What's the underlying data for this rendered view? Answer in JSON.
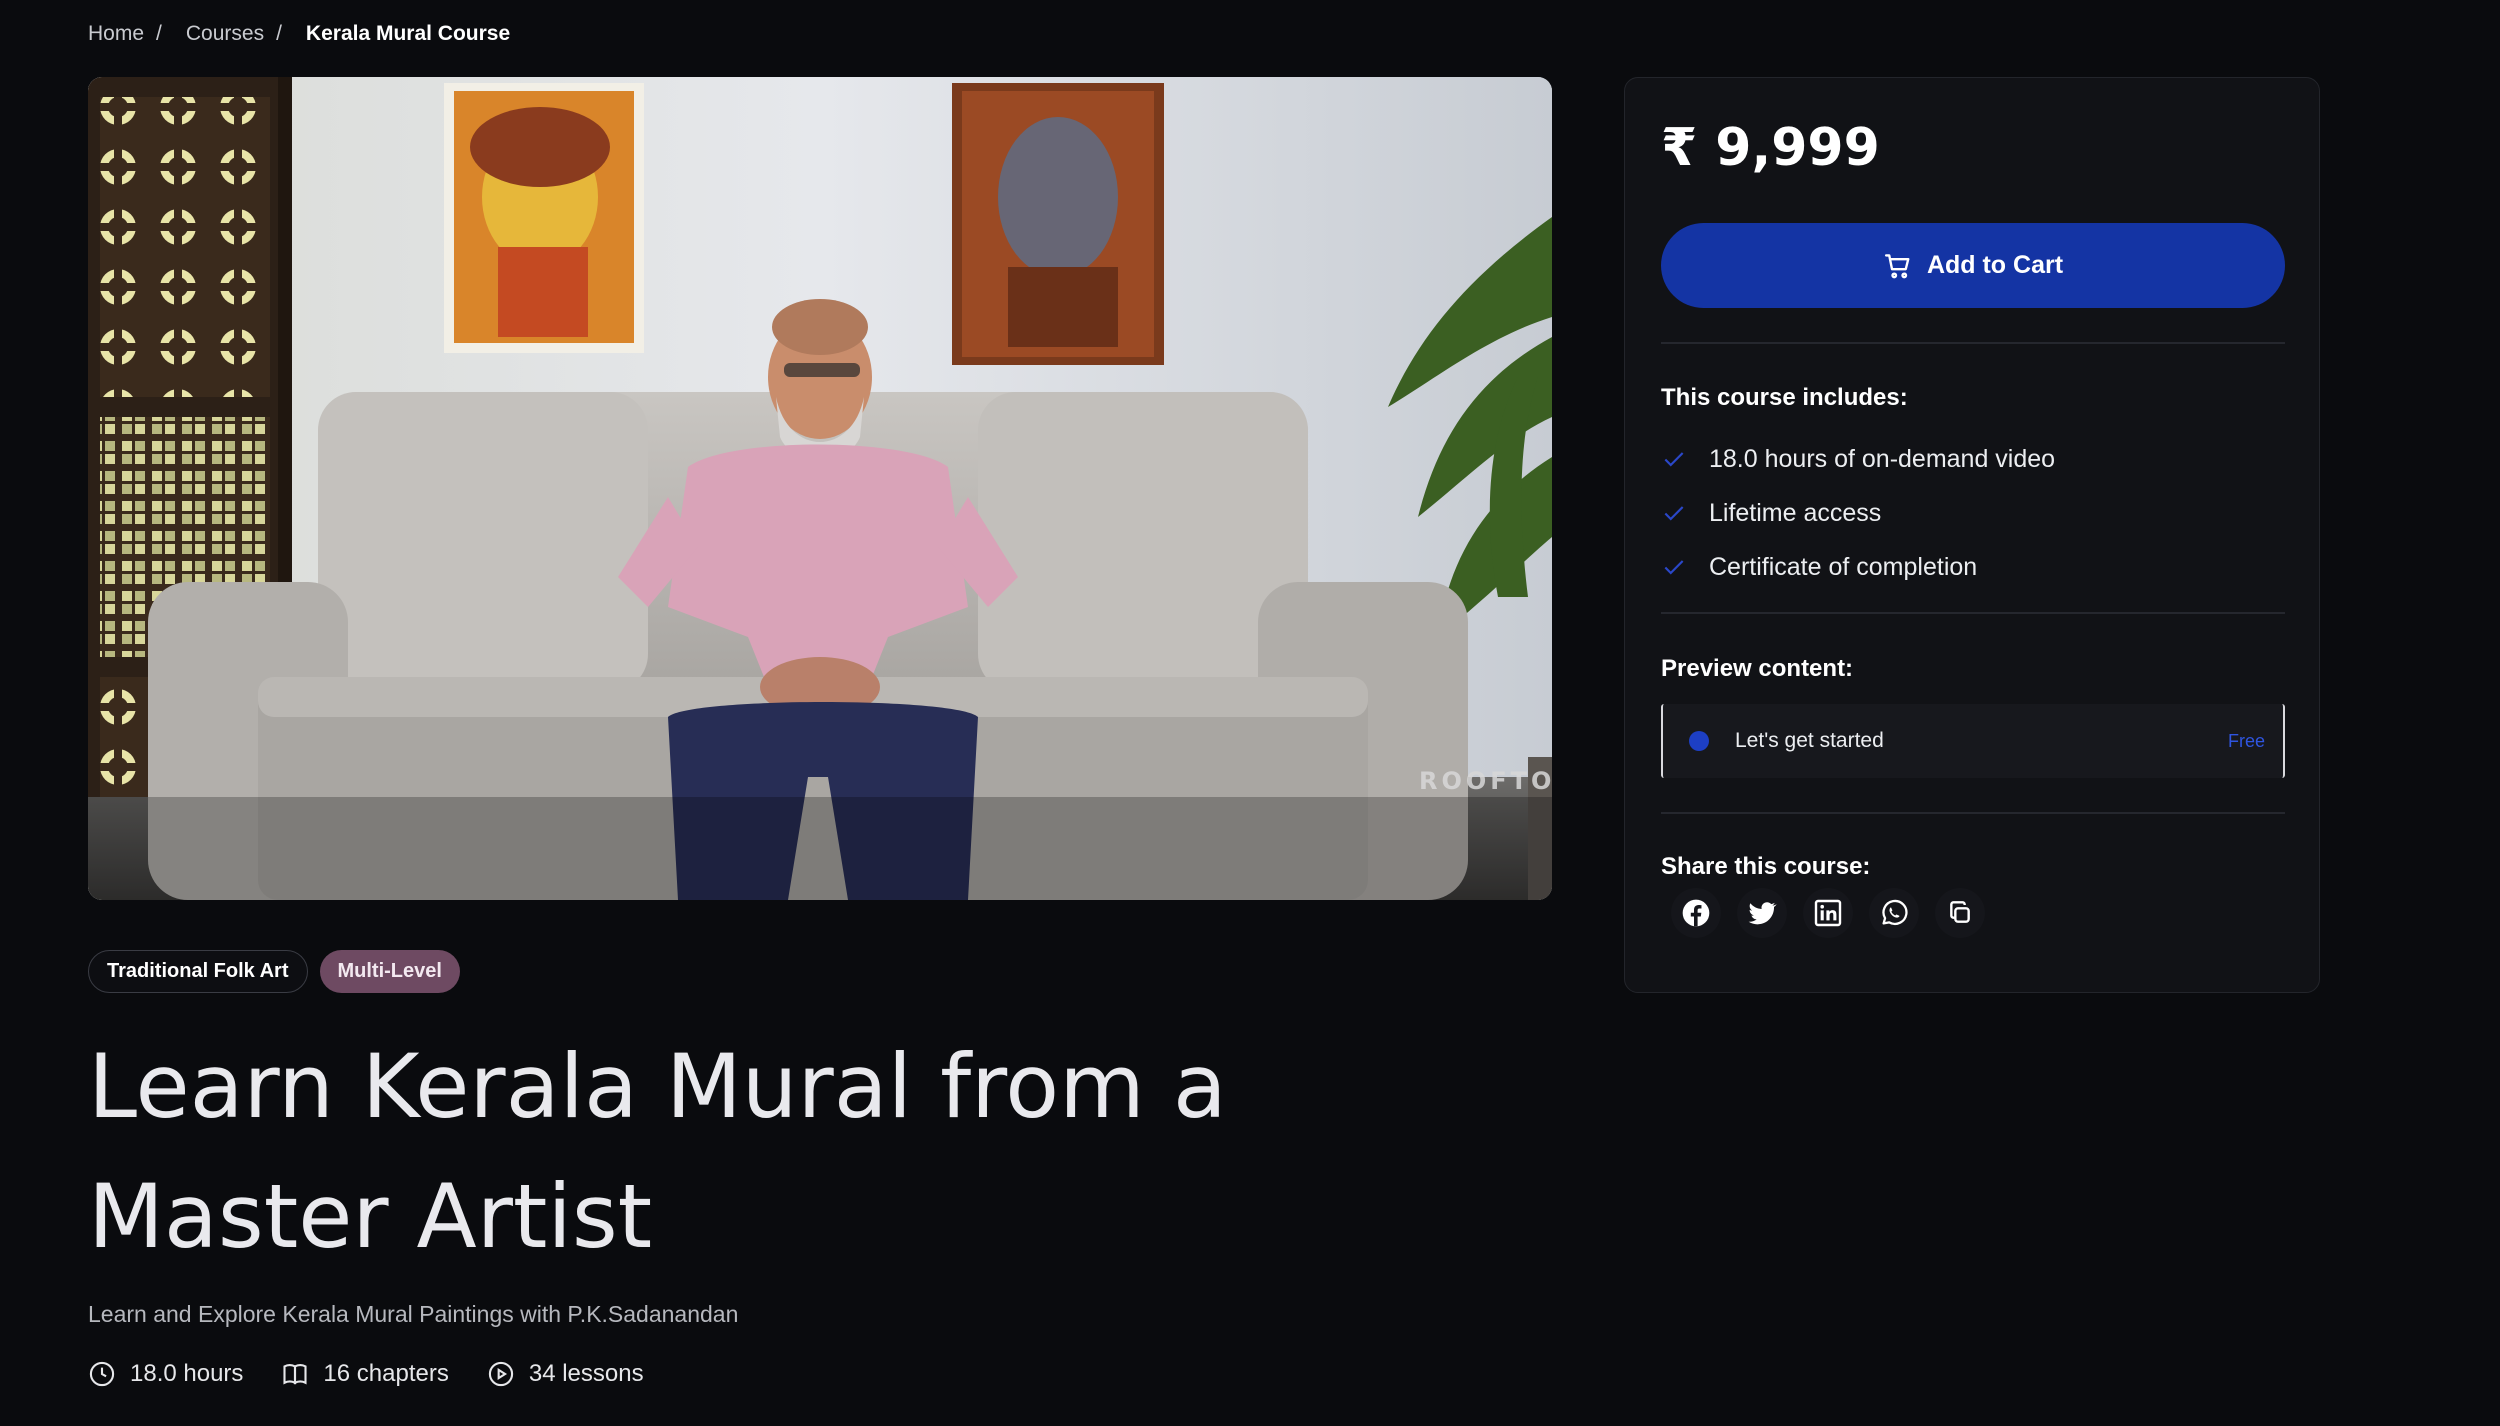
{
  "breadcrumb": {
    "home": "Home",
    "courses": "Courses",
    "current": "Kerala Mural Course",
    "separator": "/"
  },
  "hero": {
    "watermark": "ROOFTOP"
  },
  "tags": {
    "category": "Traditional Folk Art",
    "level": "Multi-Level"
  },
  "course": {
    "title": "Learn Kerala Mural from a Master Artist",
    "subtitle": "Learn and Explore Kerala Mural Paintings with P.K.Sadanandan",
    "stats": {
      "hours": "18.0 hours",
      "chapters": "16 chapters",
      "lessons": "34 lessons"
    }
  },
  "sidebar": {
    "price": "₹ 9,999",
    "add_to_cart": "Add to Cart",
    "includes_label": "This course includes:",
    "includes": [
      "18.0 hours of on-demand video",
      "Lifetime access",
      "Certificate of completion"
    ],
    "preview_label": "Preview content:",
    "preview": {
      "lesson": "Let's get started",
      "badge": "Free"
    },
    "share_label": "Share this course:",
    "share_icons": [
      "facebook-icon",
      "twitter-icon",
      "linkedin-icon",
      "whatsapp-icon",
      "copy-link-icon"
    ]
  },
  "colors": {
    "background": "#0a0b0e",
    "card": "#111216",
    "accent": "#1434a4",
    "level_tag": "#6e4a62",
    "check": "#2a47c9"
  }
}
